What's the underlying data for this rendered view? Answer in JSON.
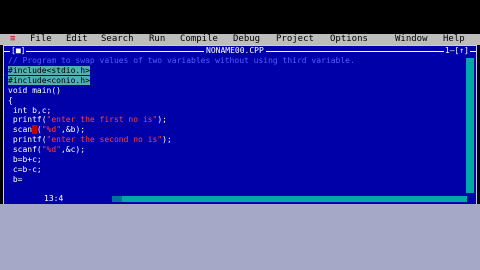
{
  "menu": {
    "system": "≡",
    "items": [
      "File",
      "Edit",
      "Search",
      "Run",
      "Compile",
      "Debug",
      "Project",
      "Options",
      "Window",
      "Help"
    ]
  },
  "editor": {
    "filename": "NONAME00.CPP",
    "close_button": "[■]",
    "window_controls": "1–[↑]",
    "lines": {
      "l1": "// Program to swap values of two variables without using third variable.",
      "l2": "#include<stdio.h>",
      "l3": "#include<conio.h>",
      "l4": "void main()",
      "l5": "{",
      "l6": " int b,c;",
      "l7a": " printf(",
      "l7b": "\"enter the first no is\"",
      "l7c": ");",
      "l8a": " scan",
      "l8b": "f",
      "l8c": "(",
      "l8d": "\"%d\"",
      "l8e": ",&b);",
      "l9a": " printf(",
      "l9b": "\"enter the second no is\"",
      "l9c": ");",
      "l10a": " scanf(",
      "l10b": "\"%d\"",
      "l10c": ",&c);",
      "l11": " b=b+c;",
      "l12": " c=b-c;",
      "l13": " b="
    },
    "cursor_position": "13:4"
  }
}
